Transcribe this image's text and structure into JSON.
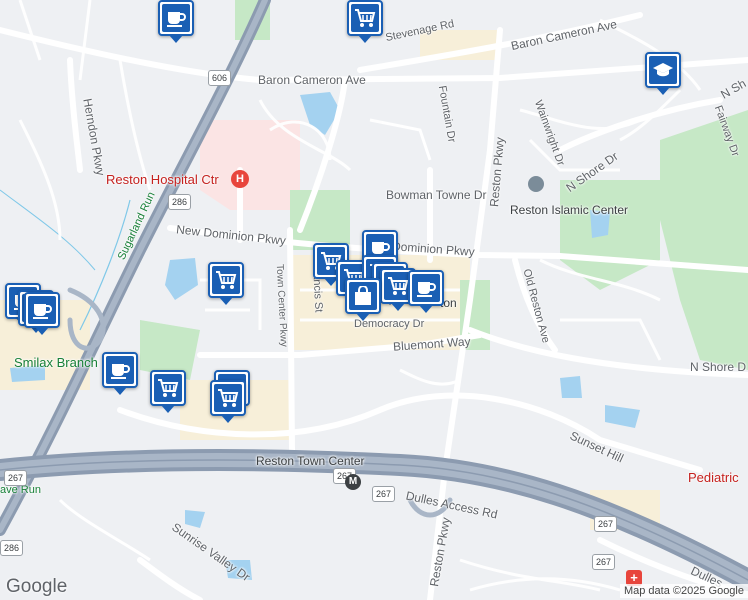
{
  "map": {
    "attribution": "Map data ©2025 Google",
    "logo": "Google",
    "colors": {
      "background": "#eef0f3",
      "highway": "#8c9bb0",
      "arterial": "#ffffff",
      "park": "#c6e8c6",
      "water": "#a4d2f0",
      "commercial": "#f7efd9",
      "hospital_area": "#fbe4e4",
      "pin_blue": "#1a5fb4"
    }
  },
  "labels": {
    "reston_hospital": "Reston Hospital Ctr",
    "reston_islamic": "Reston Islamic Center",
    "smilax": "Smilax Branch",
    "pediatric": "Pediatric",
    "reston_town_center": "Reston Town Center",
    "sugarland_run": "Sugarland Run",
    "cave_run": "ave Run",
    "baron_cameron_1": "Baron Cameron Ave",
    "baron_cameron_2": "Baron Cameron Ave",
    "stevenage": "Stevenage Rd",
    "herndon": "Herndon Pkwy",
    "fountain": "Fountain Dr",
    "reston_pkwy": "Reston Pkwy",
    "reston_pkwy_2": "Reston Pkwy",
    "wainwright": "Wainwright Dr",
    "n_shore": "N Shore Dr",
    "n_shore_2": "N Shore D",
    "n_shore_3": "N Sh",
    "fairway": "Fairway Dr",
    "bowman": "Bowman Towne Dr",
    "new_dominion": "New Dominion Pkwy",
    "new_dominion_2": "Dominion Pkwy",
    "town_center_pkwy": "Town Center Pkwy",
    "st_francis": "rancis St",
    "democracy": "Democracy Dr",
    "bluemont": "Bluemont Way",
    "old_reston": "Old Reston Ave",
    "sunset_hills": "Sunset Hill",
    "dulles_access": "Dulles Access Rd",
    "dulles_2": "Dulles",
    "sunrise_valley": "Sunrise Valley Dr",
    "reston_partial": "ton",
    "shield_606": "606",
    "shield_286": "286",
    "shield_286b": "286",
    "shield_267a": "267",
    "shield_267b": "267",
    "shield_267c": "267",
    "shield_267d": "267",
    "shield_267e": "267"
  },
  "markers": [
    {
      "type": "cafe",
      "icon": "coffee-cup-icon"
    },
    {
      "type": "grocery",
      "icon": "shopping-cart-icon"
    },
    {
      "type": "school",
      "icon": "graduation-cap-icon"
    },
    {
      "type": "cafe",
      "icon": "coffee-cup-icon"
    },
    {
      "type": "grocery",
      "icon": "shopping-cart-icon"
    },
    {
      "type": "grocery",
      "icon": "shopping-cart-icon"
    },
    {
      "type": "grocery",
      "icon": "shopping-cart-icon"
    },
    {
      "type": "grocery",
      "icon": "shopping-cart-icon"
    },
    {
      "type": "grocery",
      "icon": "shopping-cart-icon"
    },
    {
      "type": "shopping",
      "icon": "shopping-bag-icon"
    },
    {
      "type": "cafe",
      "icon": "coffee-cup-icon"
    },
    {
      "type": "cafe",
      "icon": "coffee-cup-icon"
    },
    {
      "type": "cafe",
      "icon": "coffee-cup-icon"
    },
    {
      "type": "cafe",
      "icon": "coffee-cup-icon"
    },
    {
      "type": "grocery",
      "icon": "shopping-cart-icon"
    },
    {
      "type": "cafe",
      "icon": "coffee-cup-icon"
    },
    {
      "type": "cafe",
      "icon": "coffee-cup-icon"
    },
    {
      "type": "grocery",
      "icon": "shopping-cart-icon"
    },
    {
      "type": "grocery",
      "icon": "shopping-cart-icon"
    }
  ]
}
